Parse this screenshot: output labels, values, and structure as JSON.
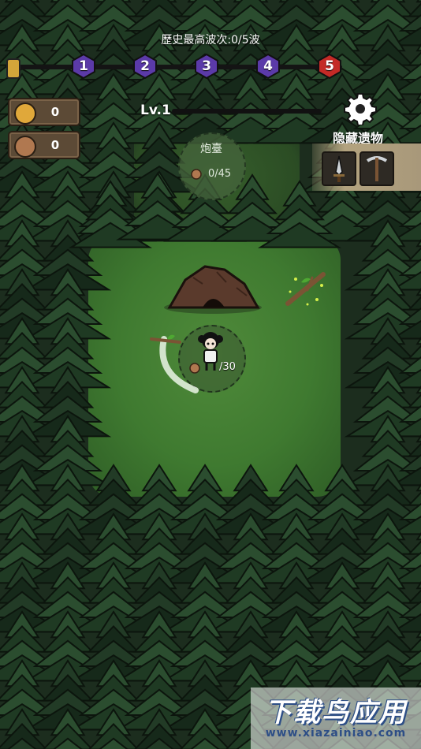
{
  "hud": {
    "wave_title": "歷史最高波次:0/5波",
    "waves": [
      "1",
      "2",
      "3",
      "4",
      "5"
    ],
    "wave_colors": [
      "#5b3aa8",
      "#5b3aa8",
      "#5b3aa8",
      "#5b3aa8",
      "#c42a26"
    ],
    "level_label": "Lv.1"
  },
  "resources": [
    {
      "icon": "gold-coin-icon",
      "value": "0",
      "color": "#e0a83a"
    },
    {
      "icon": "wood-log-icon",
      "value": "0",
      "color": "#b07850"
    }
  ],
  "relics": {
    "title": "隐藏遗物",
    "items": [
      "sword-icon",
      "pickaxe-icon"
    ]
  },
  "turret": {
    "name": "炮臺",
    "cost": "0/45"
  },
  "player": {
    "cost": "/30"
  },
  "watermark": {
    "main": "下载鸟应用",
    "sub": "www.xiazainiao.com"
  }
}
